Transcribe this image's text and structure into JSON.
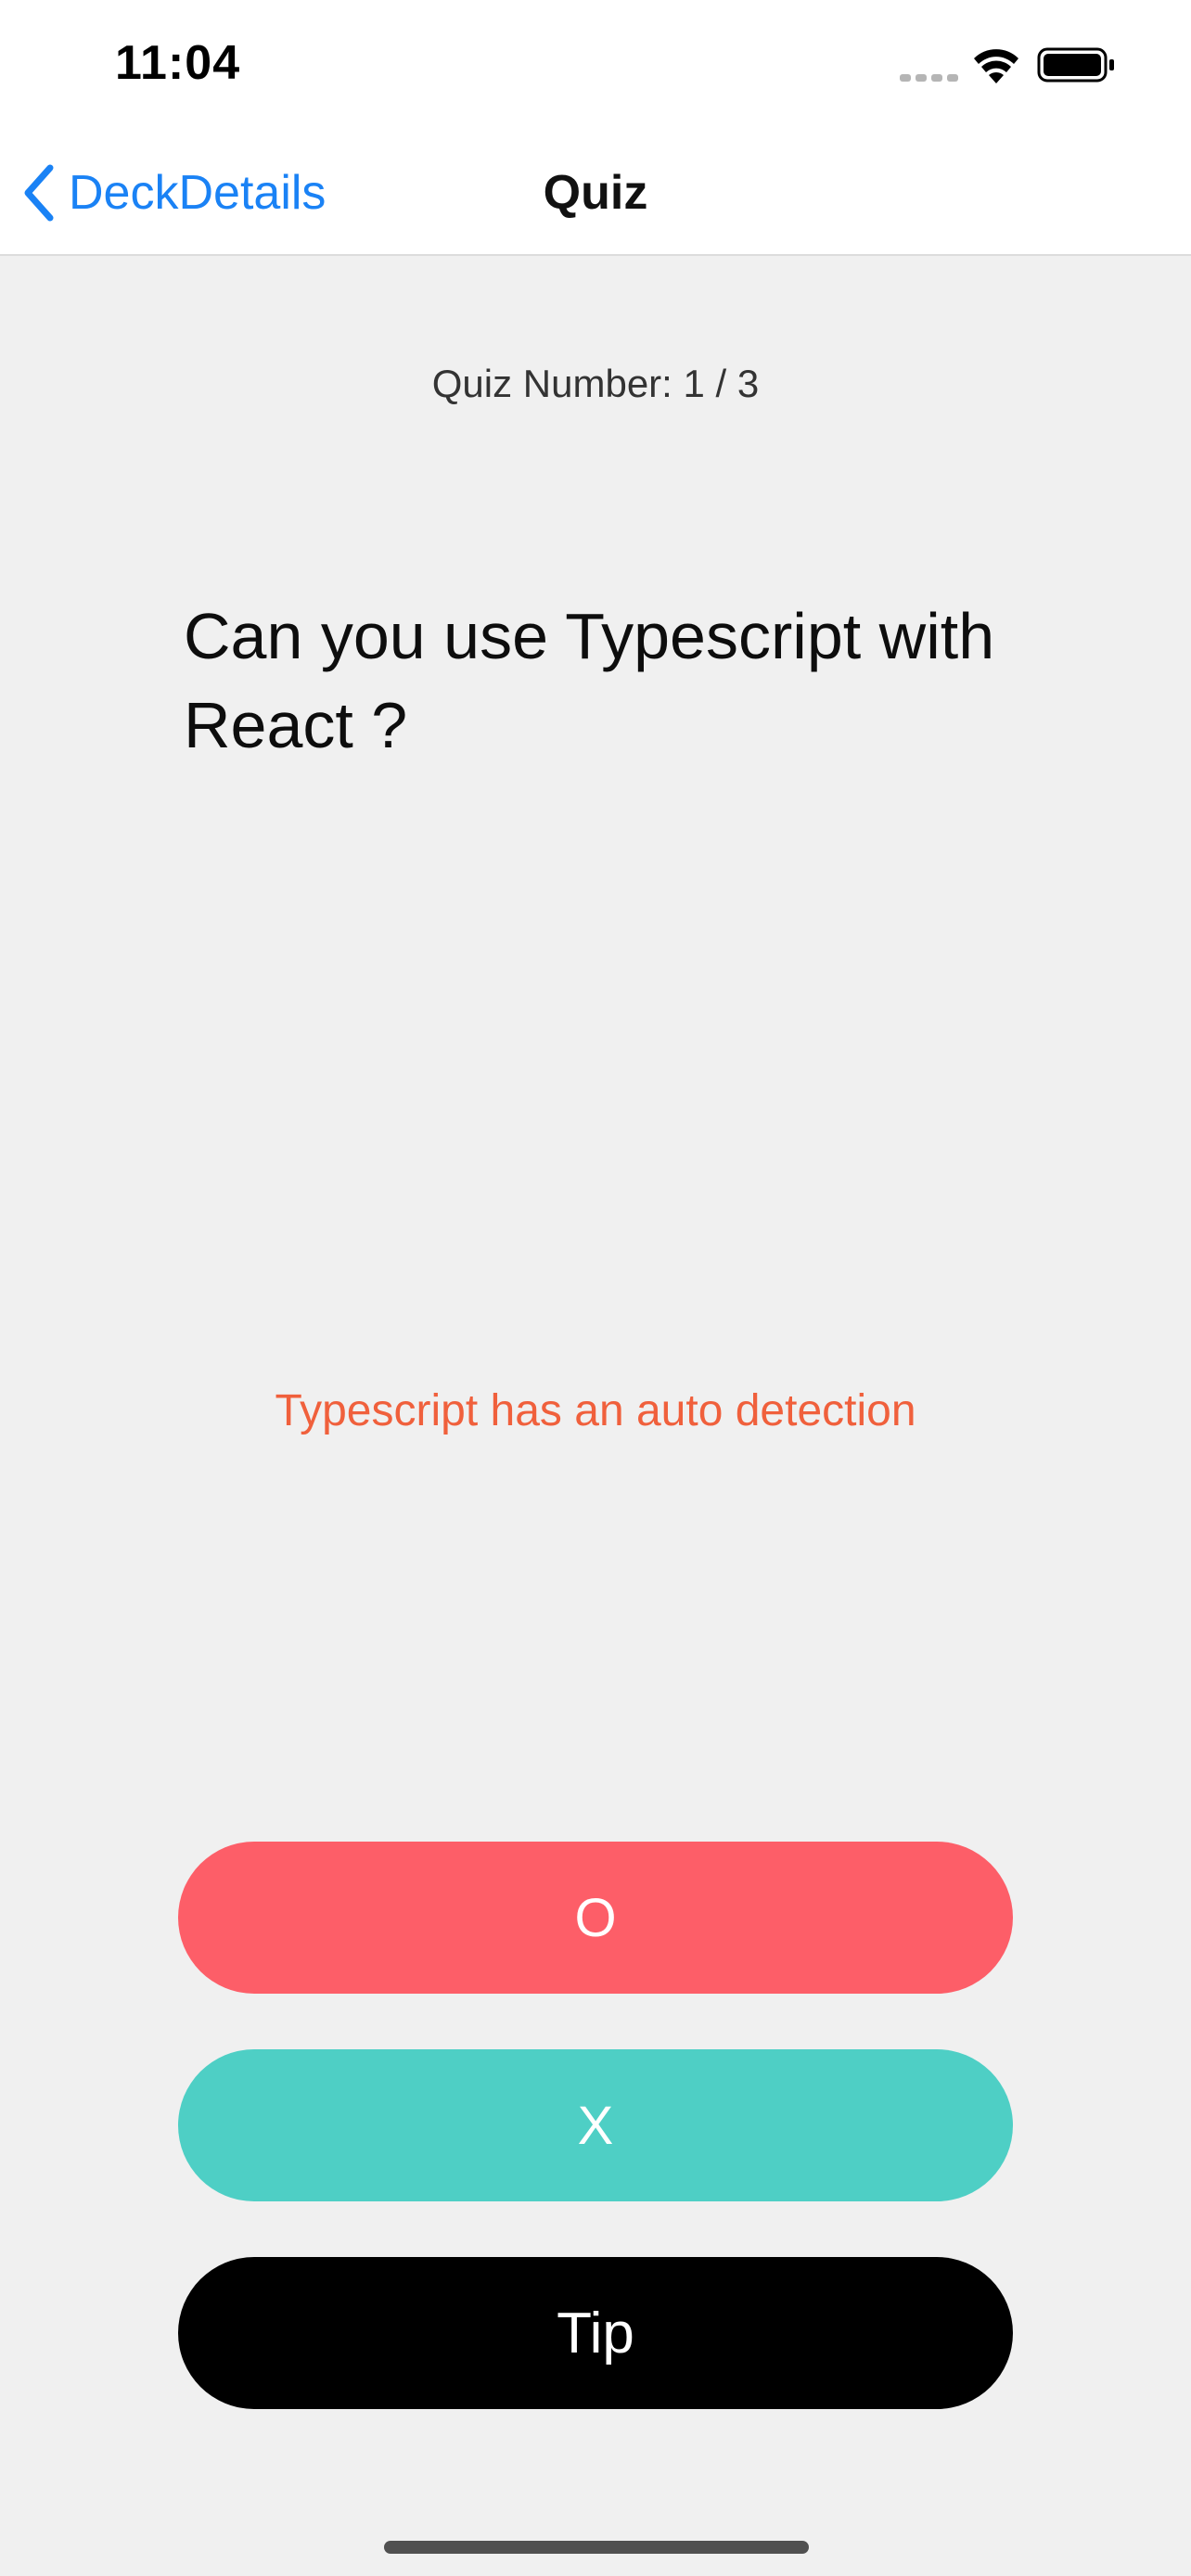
{
  "status_bar": {
    "time": "11:04"
  },
  "nav": {
    "back_label": "DeckDetails",
    "title": "Quiz"
  },
  "quiz": {
    "number_label": "Quiz Number: 1 / 3",
    "question": "Can you use Typescript with React ?",
    "answer_hint": "Typescript has an auto detection"
  },
  "buttons": {
    "correct_label": "O",
    "incorrect_label": "X",
    "tip_label": "Tip"
  },
  "colors": {
    "accent_blue": "#1a82f5",
    "hint_orange": "#f0603c",
    "correct_red": "#fd5e68",
    "incorrect_teal": "#4ecfc5",
    "tip_black": "#000000",
    "background": "#f0f0f0"
  },
  "icons": {
    "back": "chevron-left-icon",
    "signal": "cellular-signal-icon",
    "wifi": "wifi-icon",
    "battery": "battery-icon"
  }
}
